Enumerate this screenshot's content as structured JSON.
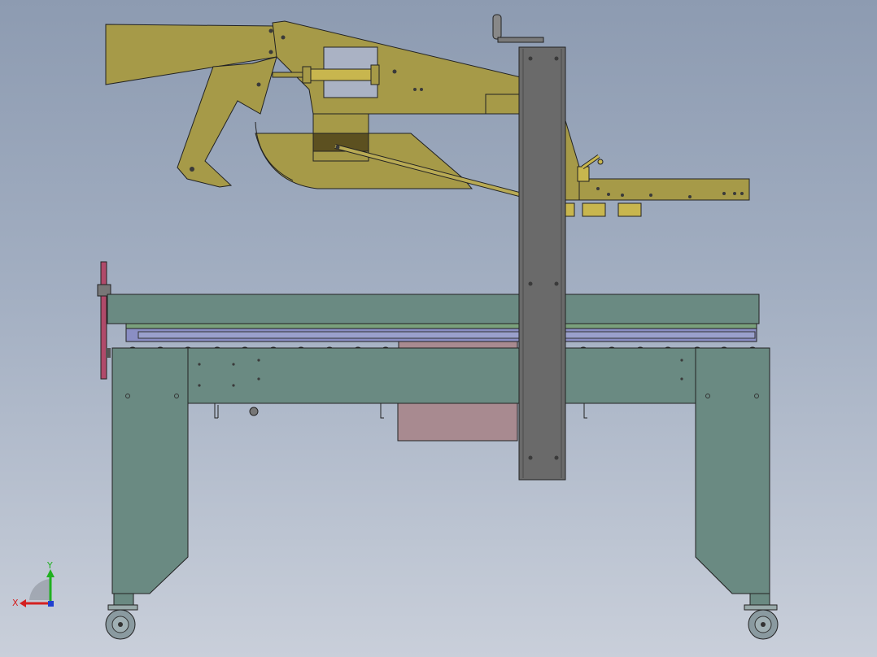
{
  "viewport": {
    "background_top": "#8d9bb1",
    "background_bottom": "#c9cfda"
  },
  "colors": {
    "upper_mechanism": "#a69a48",
    "upper_dark": "#5c5020",
    "table_frame": "#6a8a82",
    "roller_plate": "#8a8ec4",
    "column": "#6a6a6a",
    "pink_box": "#a88a90",
    "red_post": "#b04a6a"
  },
  "triad": {
    "x_label": "X",
    "y_label": "Y",
    "x_color": "#d42020",
    "y_color": "#20b020",
    "z_color": "#2040d0"
  },
  "icons": [
    "crank-handle-icon",
    "caster-wheel-icon",
    "coordinate-triad-icon"
  ]
}
